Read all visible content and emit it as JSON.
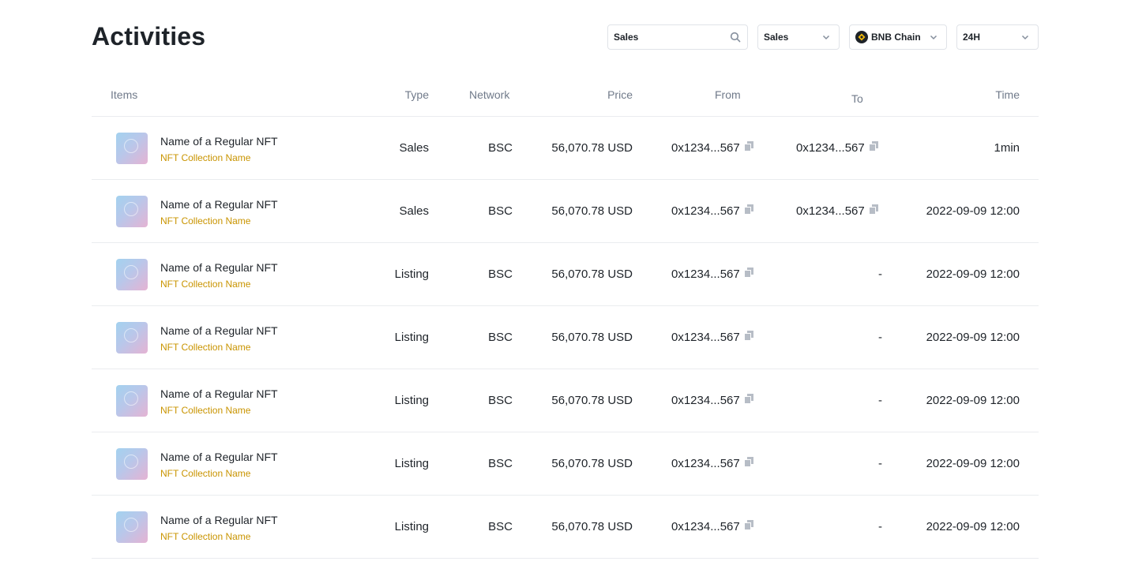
{
  "page": {
    "title": "Activities"
  },
  "filters": {
    "search_value": "Sales",
    "search_icon": "search-icon",
    "type_selected": "Sales",
    "chain_selected": "BNB Chain",
    "chain_icon": "bnb-chain-logo",
    "time_selected": "24H"
  },
  "table": {
    "headers": {
      "items": "Items",
      "type": "Type",
      "network": "Network",
      "price": "Price",
      "from": "From",
      "to": "To",
      "time": "Time"
    },
    "rows": [
      {
        "name": "Name of a Regular NFT",
        "collection": "NFT Collection Name",
        "type": "Sales",
        "network": "BSC",
        "price": "56,070.78 USD",
        "from": "0x1234...567",
        "to": "0x1234...567",
        "time": "1min"
      },
      {
        "name": "Name of a Regular NFT",
        "collection": "NFT Collection Name",
        "type": "Sales",
        "network": "BSC",
        "price": "56,070.78 USD",
        "from": "0x1234...567",
        "to": "0x1234...567",
        "time": "2022-09-09 12:00"
      },
      {
        "name": "Name of a Regular NFT",
        "collection": "NFT Collection Name",
        "type": "Listing",
        "network": "BSC",
        "price": "56,070.78 USD",
        "from": "0x1234...567",
        "to": "-",
        "time": "2022-09-09 12:00"
      },
      {
        "name": "Name of a Regular NFT",
        "collection": "NFT Collection Name",
        "type": "Listing",
        "network": "BSC",
        "price": "56,070.78 USD",
        "from": "0x1234...567",
        "to": "-",
        "time": "2022-09-09 12:00"
      },
      {
        "name": "Name of a Regular NFT",
        "collection": "NFT Collection Name",
        "type": "Listing",
        "network": "BSC",
        "price": "56,070.78 USD",
        "from": "0x1234...567",
        "to": "-",
        "time": "2022-09-09 12:00"
      },
      {
        "name": "Name of a Regular NFT",
        "collection": "NFT Collection Name",
        "type": "Listing",
        "network": "BSC",
        "price": "56,070.78 USD",
        "from": "0x1234...567",
        "to": "-",
        "time": "2022-09-09 12:00"
      },
      {
        "name": "Name of a Regular NFT",
        "collection": "NFT Collection Name",
        "type": "Listing",
        "network": "BSC",
        "price": "56,070.78 USD",
        "from": "0x1234...567",
        "to": "-",
        "time": "2022-09-09 12:00"
      }
    ]
  },
  "colors": {
    "text": "#1e2329",
    "muted": "#707a8a",
    "collection": "#c99400",
    "border": "#eaecef",
    "icon": "#b7bdc6"
  }
}
